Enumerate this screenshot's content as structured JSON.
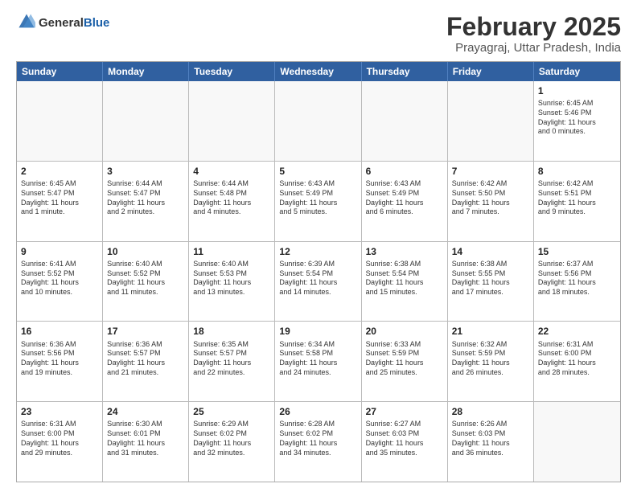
{
  "logo": {
    "general": "General",
    "blue": "Blue"
  },
  "title": "February 2025",
  "subtitle": "Prayagraj, Uttar Pradesh, India",
  "headers": [
    "Sunday",
    "Monday",
    "Tuesday",
    "Wednesday",
    "Thursday",
    "Friday",
    "Saturday"
  ],
  "weeks": [
    [
      {
        "day": "",
        "info": ""
      },
      {
        "day": "",
        "info": ""
      },
      {
        "day": "",
        "info": ""
      },
      {
        "day": "",
        "info": ""
      },
      {
        "day": "",
        "info": ""
      },
      {
        "day": "",
        "info": ""
      },
      {
        "day": "1",
        "info": "Sunrise: 6:45 AM\nSunset: 5:46 PM\nDaylight: 11 hours\nand 0 minutes."
      }
    ],
    [
      {
        "day": "2",
        "info": "Sunrise: 6:45 AM\nSunset: 5:47 PM\nDaylight: 11 hours\nand 1 minute."
      },
      {
        "day": "3",
        "info": "Sunrise: 6:44 AM\nSunset: 5:47 PM\nDaylight: 11 hours\nand 2 minutes."
      },
      {
        "day": "4",
        "info": "Sunrise: 6:44 AM\nSunset: 5:48 PM\nDaylight: 11 hours\nand 4 minutes."
      },
      {
        "day": "5",
        "info": "Sunrise: 6:43 AM\nSunset: 5:49 PM\nDaylight: 11 hours\nand 5 minutes."
      },
      {
        "day": "6",
        "info": "Sunrise: 6:43 AM\nSunset: 5:49 PM\nDaylight: 11 hours\nand 6 minutes."
      },
      {
        "day": "7",
        "info": "Sunrise: 6:42 AM\nSunset: 5:50 PM\nDaylight: 11 hours\nand 7 minutes."
      },
      {
        "day": "8",
        "info": "Sunrise: 6:42 AM\nSunset: 5:51 PM\nDaylight: 11 hours\nand 9 minutes."
      }
    ],
    [
      {
        "day": "9",
        "info": "Sunrise: 6:41 AM\nSunset: 5:52 PM\nDaylight: 11 hours\nand 10 minutes."
      },
      {
        "day": "10",
        "info": "Sunrise: 6:40 AM\nSunset: 5:52 PM\nDaylight: 11 hours\nand 11 minutes."
      },
      {
        "day": "11",
        "info": "Sunrise: 6:40 AM\nSunset: 5:53 PM\nDaylight: 11 hours\nand 13 minutes."
      },
      {
        "day": "12",
        "info": "Sunrise: 6:39 AM\nSunset: 5:54 PM\nDaylight: 11 hours\nand 14 minutes."
      },
      {
        "day": "13",
        "info": "Sunrise: 6:38 AM\nSunset: 5:54 PM\nDaylight: 11 hours\nand 15 minutes."
      },
      {
        "day": "14",
        "info": "Sunrise: 6:38 AM\nSunset: 5:55 PM\nDaylight: 11 hours\nand 17 minutes."
      },
      {
        "day": "15",
        "info": "Sunrise: 6:37 AM\nSunset: 5:56 PM\nDaylight: 11 hours\nand 18 minutes."
      }
    ],
    [
      {
        "day": "16",
        "info": "Sunrise: 6:36 AM\nSunset: 5:56 PM\nDaylight: 11 hours\nand 19 minutes."
      },
      {
        "day": "17",
        "info": "Sunrise: 6:36 AM\nSunset: 5:57 PM\nDaylight: 11 hours\nand 21 minutes."
      },
      {
        "day": "18",
        "info": "Sunrise: 6:35 AM\nSunset: 5:57 PM\nDaylight: 11 hours\nand 22 minutes."
      },
      {
        "day": "19",
        "info": "Sunrise: 6:34 AM\nSunset: 5:58 PM\nDaylight: 11 hours\nand 24 minutes."
      },
      {
        "day": "20",
        "info": "Sunrise: 6:33 AM\nSunset: 5:59 PM\nDaylight: 11 hours\nand 25 minutes."
      },
      {
        "day": "21",
        "info": "Sunrise: 6:32 AM\nSunset: 5:59 PM\nDaylight: 11 hours\nand 26 minutes."
      },
      {
        "day": "22",
        "info": "Sunrise: 6:31 AM\nSunset: 6:00 PM\nDaylight: 11 hours\nand 28 minutes."
      }
    ],
    [
      {
        "day": "23",
        "info": "Sunrise: 6:31 AM\nSunset: 6:00 PM\nDaylight: 11 hours\nand 29 minutes."
      },
      {
        "day": "24",
        "info": "Sunrise: 6:30 AM\nSunset: 6:01 PM\nDaylight: 11 hours\nand 31 minutes."
      },
      {
        "day": "25",
        "info": "Sunrise: 6:29 AM\nSunset: 6:02 PM\nDaylight: 11 hours\nand 32 minutes."
      },
      {
        "day": "26",
        "info": "Sunrise: 6:28 AM\nSunset: 6:02 PM\nDaylight: 11 hours\nand 34 minutes."
      },
      {
        "day": "27",
        "info": "Sunrise: 6:27 AM\nSunset: 6:03 PM\nDaylight: 11 hours\nand 35 minutes."
      },
      {
        "day": "28",
        "info": "Sunrise: 6:26 AM\nSunset: 6:03 PM\nDaylight: 11 hours\nand 36 minutes."
      },
      {
        "day": "",
        "info": ""
      }
    ]
  ]
}
